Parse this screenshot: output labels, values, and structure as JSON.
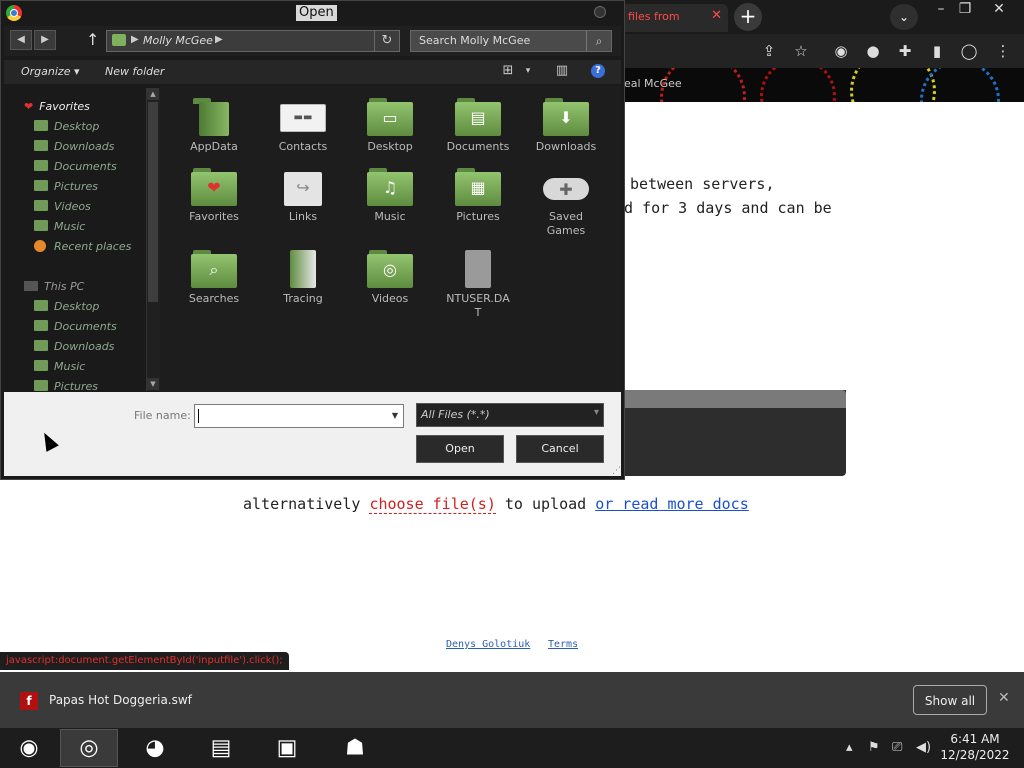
{
  "browser": {
    "tab_title": "files from",
    "bookmark_text": "eal McGee",
    "body_line1": "between servers,",
    "body_line2": "d for 3 days and can be",
    "alt_prefix": "alternatively",
    "alt_choose": "choose file(s)",
    "alt_mid": "to upload",
    "alt_more": "or read more docs",
    "footer_author": "Denys Golotiuk",
    "footer_terms": "Terms",
    "status_url": "javascript:document.getElementById('inputfile').click();"
  },
  "download_bar": {
    "file_name": "Papas Hot Doggeria.swf",
    "show_all_label": "Show all"
  },
  "taskbar": {
    "time": "6:41 AM",
    "date": "12/28/2022"
  },
  "dialog": {
    "title": "Open",
    "path": "Molly McGee",
    "search_placeholder": "Search Molly McGee",
    "organize_label": "Organize",
    "new_folder_label": "New folder",
    "favorites_header": "Favorites",
    "favorites": [
      "Desktop",
      "Downloads",
      "Documents",
      "Pictures",
      "Videos",
      "Music",
      "Recent places"
    ],
    "this_pc_header": "This PC",
    "this_pc": [
      "Desktop",
      "Documents",
      "Downloads",
      "Music",
      "Pictures"
    ],
    "files": [
      {
        "name": "AppData",
        "icon": "appdata-folder-icon"
      },
      {
        "name": "Contacts",
        "icon": "contacts-icon"
      },
      {
        "name": "Desktop",
        "icon": "desktop-folder-icon"
      },
      {
        "name": "Documents",
        "icon": "documents-folder-icon"
      },
      {
        "name": "Downloads",
        "icon": "downloads-folder-icon"
      },
      {
        "name": "Favorites",
        "icon": "favorites-folder-icon"
      },
      {
        "name": "Links",
        "icon": "links-icon"
      },
      {
        "name": "Music",
        "icon": "music-folder-icon"
      },
      {
        "name": "Pictures",
        "icon": "pictures-folder-icon"
      },
      {
        "name": "Saved Games",
        "icon": "saved-games-icon"
      },
      {
        "name": "Searches",
        "icon": "searches-folder-icon"
      },
      {
        "name": "Tracing",
        "icon": "tracing-folder-icon"
      },
      {
        "name": "Videos",
        "icon": "videos-folder-icon"
      },
      {
        "name": "NTUSER.DAT",
        "icon": "file-icon"
      }
    ],
    "file_name_label": "File name:",
    "file_name_value": "",
    "filter_value": "All Files (*.*)",
    "open_label": "Open",
    "cancel_label": "Cancel"
  },
  "colors": {
    "folder_green": "#7fb060",
    "dialog_bg": "#1d1d1d",
    "accent_red": "#d02020"
  }
}
